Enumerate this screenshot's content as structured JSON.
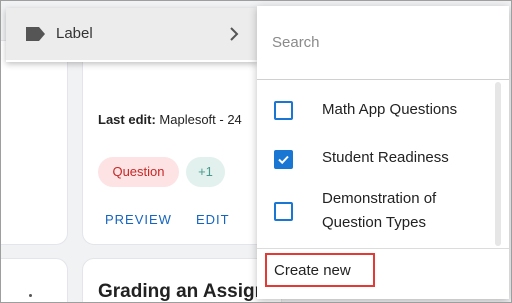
{
  "label_menu": {
    "label": "Label",
    "icon": "label-tag-icon",
    "chevron_icon": "chevron-right-icon"
  },
  "dropdown": {
    "search_placeholder": "Search",
    "options": [
      {
        "label": "Math App Questions",
        "checked": false
      },
      {
        "label": "Student Readiness",
        "checked": true
      },
      {
        "label": "Demonstration of Question Types",
        "checked": false
      }
    ],
    "create_new_label": "Create new"
  },
  "card": {
    "last_edit_label": "Last edit:",
    "last_edit_value": " Maplesoft - 24",
    "tags": [
      "Question",
      "+1"
    ],
    "preview_label": "PREVIEW",
    "edit_label": "EDIT"
  },
  "next_card": {
    "title": "Grading an Assign"
  },
  "colors": {
    "accent": "#1976d2",
    "link": "#1565c0",
    "question_tag_bg": "#fde3e3",
    "question_tag_text": "#c62828",
    "highlight_border": "#e53935"
  }
}
